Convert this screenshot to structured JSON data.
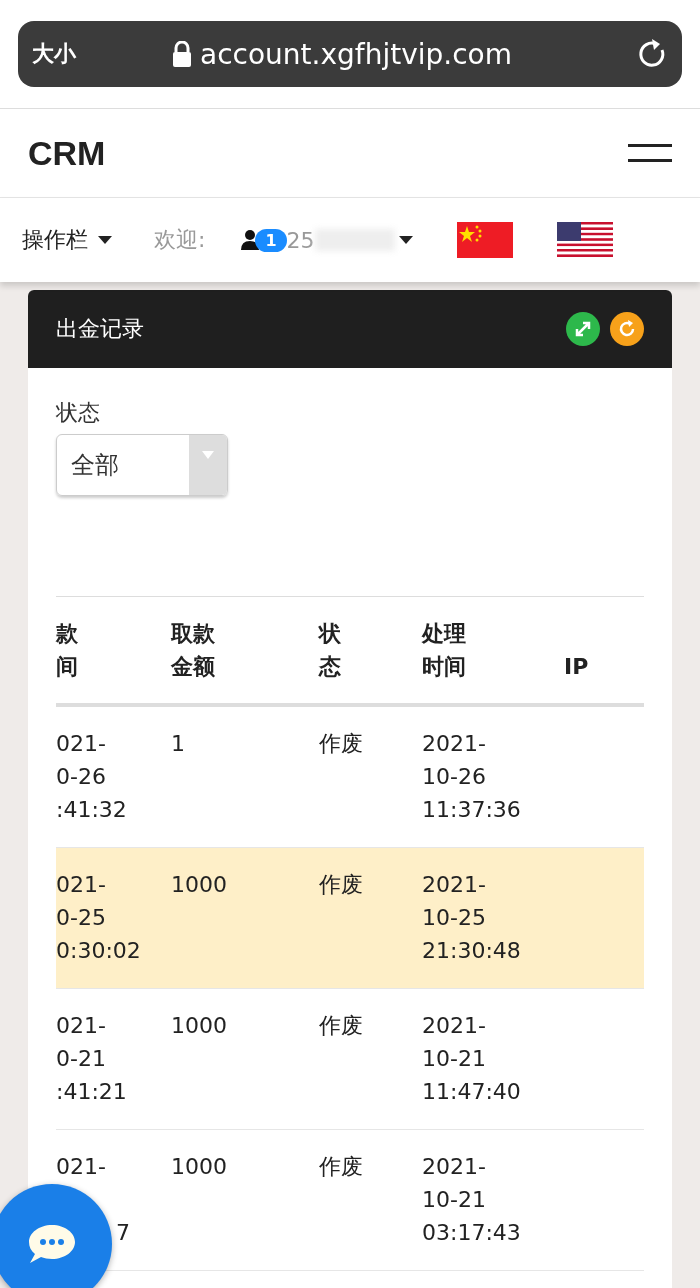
{
  "browser": {
    "text_size": "大小",
    "url": "account.xgfhjtvip.com"
  },
  "header": {
    "logo": "CRM"
  },
  "nav": {
    "menu": "操作栏",
    "welcome": "欢迎:",
    "badge": "1",
    "user": "25"
  },
  "panel": {
    "title": "出金记录",
    "filter": {
      "label": "状态",
      "value": "全部"
    },
    "columns": [
      [
        "款",
        "间"
      ],
      [
        "取款",
        "金额"
      ],
      [
        "状",
        "态"
      ],
      [
        "处理",
        "时间"
      ],
      [
        "IP"
      ]
    ],
    "rows": [
      {
        "selected": false,
        "time": [
          "021-",
          "0-26",
          ":41:32"
        ],
        "amount": "1",
        "status": "作废",
        "processed": [
          "2021-",
          "10-26",
          "11:37:36"
        ]
      },
      {
        "selected": true,
        "time": [
          "021-",
          "0-25",
          "0:30:02"
        ],
        "amount": "1000",
        "status": "作废",
        "processed": [
          "2021-",
          "10-25",
          "21:30:48"
        ]
      },
      {
        "selected": false,
        "time": [
          "021-",
          "0-21",
          ":41:21"
        ],
        "amount": "1000",
        "status": "作废",
        "processed": [
          "2021-",
          "10-21",
          "11:47:40"
        ]
      },
      {
        "selected": false,
        "time": [
          "021-",
          "7"
        ],
        "amount": "1000",
        "status": "作废",
        "processed": [
          "2021-",
          "10-21",
          "03:17:43"
        ]
      }
    ]
  }
}
